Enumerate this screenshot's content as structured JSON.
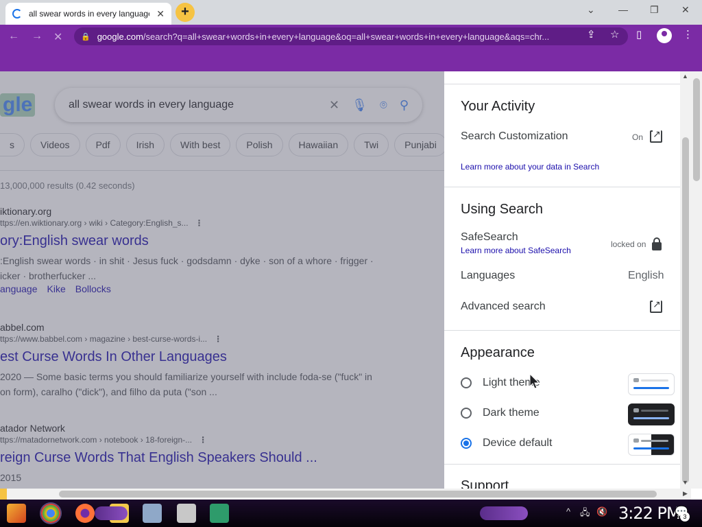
{
  "tab": {
    "title": "all swear words in every language",
    "close": "✕"
  },
  "window": {
    "minimize": "—",
    "restore": "❐",
    "close": "✕",
    "dropdown": "⌄"
  },
  "address": {
    "host": "google.com",
    "path": "/search?q=all+swear+words+in+every+language&oq=all+swear+words+in+every+language&aqs=chr..."
  },
  "search": {
    "query": "all swear words in every language",
    "chips": [
      "s",
      "Videos",
      "Pdf",
      "Irish",
      "With best",
      "Polish",
      "Hawaiian",
      "Twi",
      "Punjabi"
    ],
    "stats": "13,000,000 results (0.42 seconds)",
    "logo_fragment": "gle"
  },
  "results": [
    {
      "site": "iktionary.org",
      "crumb": "ttps://en.wiktionary.org › wiki › Category:English_s...",
      "title": "ory:English swear words",
      "snippet": ":English swear words · in shit · Jesus fuck · godsdamn · dyke · son of a whore · frigger · icker · brotherfucker ...",
      "links": [
        "anguage",
        "Kike",
        "Bollocks"
      ]
    },
    {
      "site": "abbel.com",
      "crumb": "ttps://www.babbel.com › magazine › best-curse-words-i...",
      "title": "est Curse Words In Other Languages",
      "snippet": "2020 — Some basic terms you should familiarize yourself with include foda-se (\"fuck\" in on form), caralho (\"dick\"), and filho da puta (\"son ...",
      "links": []
    },
    {
      "site": "atador Network",
      "crumb": "ttps://matadornetwork.com › notebook › 18-foreign-...",
      "title": "reign Curse Words That English Speakers Should ...",
      "snippet": "2015",
      "links": []
    }
  ],
  "panel": {
    "activity_heading": "Your Activity",
    "customization_label": "Search Customization",
    "customization_value": "On",
    "learn_data": "Learn more about your data in Search",
    "using_heading": "Using Search",
    "safesearch_label": "SafeSearch",
    "safesearch_link": "Learn more about SafeSearch",
    "safesearch_value": "locked on",
    "languages_label": "Languages",
    "languages_value": "English",
    "advanced_label": "Advanced search",
    "appearance_heading": "Appearance",
    "themes": [
      {
        "label": "Light theme",
        "selected": false
      },
      {
        "label": "Dark theme",
        "selected": false
      },
      {
        "label": "Device default",
        "selected": true
      }
    ],
    "support_heading": "Support"
  },
  "taskbar": {
    "clock": "3:22 PM",
    "notifications": "3"
  },
  "colors": {
    "chrome_accent": "#7b2ba5",
    "link": "#1a0dab",
    "radio_selected": "#1a73e8"
  }
}
